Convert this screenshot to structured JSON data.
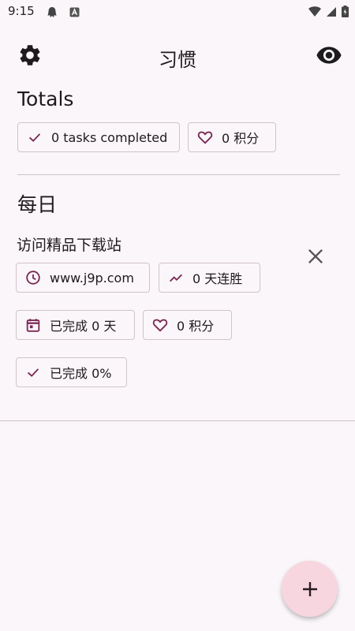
{
  "status_bar": {
    "time": "9:15",
    "icons": [
      "notification-icon",
      "app-badge-icon",
      "wifi-icon",
      "signal-icon",
      "battery-icon"
    ]
  },
  "app_bar": {
    "title": "习惯",
    "left_icon": "settings-icon",
    "right_icon": "visibility-icon"
  },
  "totals": {
    "title": "Totals",
    "tasks_completed": "0 tasks completed",
    "points": "0 积分"
  },
  "daily": {
    "title": "每日",
    "habit": {
      "name": "访问精品下载站",
      "reminder": "www.j9p.com",
      "streak": "0 天连胜",
      "days_completed": "已完成 0 天",
      "points": "0 积分",
      "percent_completed": "已完成 0%"
    }
  },
  "fab": {
    "icon": "add-icon"
  },
  "colors": {
    "accent": "#7a2a54",
    "background": "#fbf6fa",
    "fab": "#f7d6e0",
    "chip_border": "#cfc4cb"
  }
}
